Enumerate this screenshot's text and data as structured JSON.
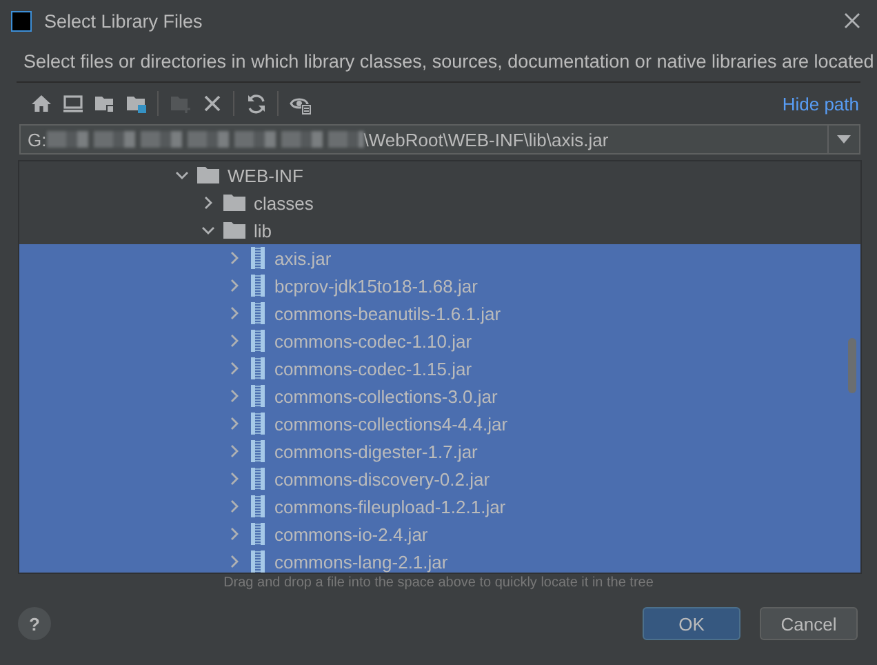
{
  "window": {
    "title": "Select Library Files"
  },
  "description": "Select files or directories in which library classes, sources, documentation or native libraries are located",
  "toolbar": [
    {
      "kind": "home",
      "disabled": false
    },
    {
      "kind": "desktop",
      "disabled": false
    },
    {
      "kind": "project",
      "disabled": false
    },
    {
      "kind": "module",
      "disabled": false
    },
    {
      "kind": "new-folder",
      "disabled": true
    },
    {
      "kind": "delete",
      "disabled": false
    },
    {
      "kind": "refresh",
      "disabled": false
    },
    {
      "kind": "show-hidden",
      "disabled": false
    }
  ],
  "hide_path_link": "Hide path",
  "path_field": {
    "drive": "G:",
    "value": "\\WebRoot\\WEB-INF\\lib\\axis.jar"
  },
  "tree": [
    {
      "label": "WEB-INF",
      "kind": "folder",
      "expanded": true,
      "selected": false,
      "children": [
        {
          "label": "classes",
          "kind": "folder",
          "expanded": false,
          "selected": false
        },
        {
          "label": "lib",
          "kind": "folder",
          "expanded": true,
          "selected": false,
          "children": [
            {
              "label": "axis.jar",
              "kind": "jar",
              "expanded": false,
              "selected": true
            },
            {
              "label": "bcprov-jdk15to18-1.68.jar",
              "kind": "jar",
              "expanded": false,
              "selected": true
            },
            {
              "label": "commons-beanutils-1.6.1.jar",
              "kind": "jar",
              "expanded": false,
              "selected": true
            },
            {
              "label": "commons-codec-1.10.jar",
              "kind": "jar",
              "expanded": false,
              "selected": true
            },
            {
              "label": "commons-codec-1.15.jar",
              "kind": "jar",
              "expanded": false,
              "selected": true
            },
            {
              "label": "commons-collections-3.0.jar",
              "kind": "jar",
              "expanded": false,
              "selected": true
            },
            {
              "label": "commons-collections4-4.4.jar",
              "kind": "jar",
              "expanded": false,
              "selected": true
            },
            {
              "label": "commons-digester-1.7.jar",
              "kind": "jar",
              "expanded": false,
              "selected": true
            },
            {
              "label": "commons-discovery-0.2.jar",
              "kind": "jar",
              "expanded": false,
              "selected": true
            },
            {
              "label": "commons-fileupload-1.2.1.jar",
              "kind": "jar",
              "expanded": false,
              "selected": true
            },
            {
              "label": "commons-io-2.4.jar",
              "kind": "jar",
              "expanded": false,
              "selected": true
            },
            {
              "label": "commons-lang-2.1.jar",
              "kind": "jar",
              "expanded": false,
              "selected": true
            }
          ]
        }
      ]
    }
  ],
  "hint": "Drag and drop a file into the space above to quickly locate it in the tree",
  "help_button": "?",
  "buttons": [
    {
      "label": "OK",
      "kind": "primary"
    },
    {
      "label": "Cancel",
      "kind": "secondary"
    }
  ]
}
